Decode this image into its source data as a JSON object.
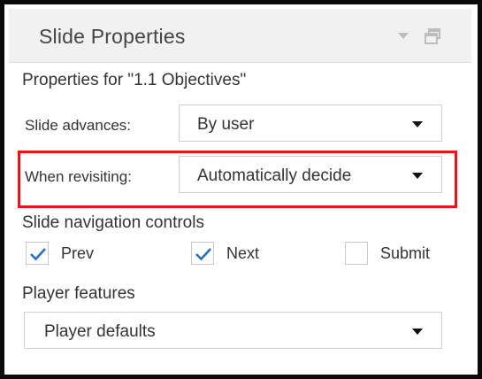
{
  "panel": {
    "title": "Slide Properties",
    "menu_icon": "dropdown-arrow-icon",
    "restore_icon": "window-restore-icon"
  },
  "properties": {
    "heading": "Properties for \"1.1 Objectives\""
  },
  "fields": {
    "slide_advances": {
      "label": "Slide advances:",
      "value": "By user"
    },
    "when_revisiting": {
      "label": "When revisiting:",
      "value": "Automatically decide"
    }
  },
  "navigation": {
    "heading": "Slide navigation controls",
    "controls": [
      {
        "label": "Prev",
        "checked": true
      },
      {
        "label": "Next",
        "checked": true
      },
      {
        "label": "Submit",
        "checked": false
      }
    ]
  },
  "player": {
    "heading": "Player features",
    "value": "Player defaults"
  },
  "colors": {
    "highlight": "#e3161f",
    "check": "#2a6fb3",
    "header_bg": "#f1f1f1"
  }
}
